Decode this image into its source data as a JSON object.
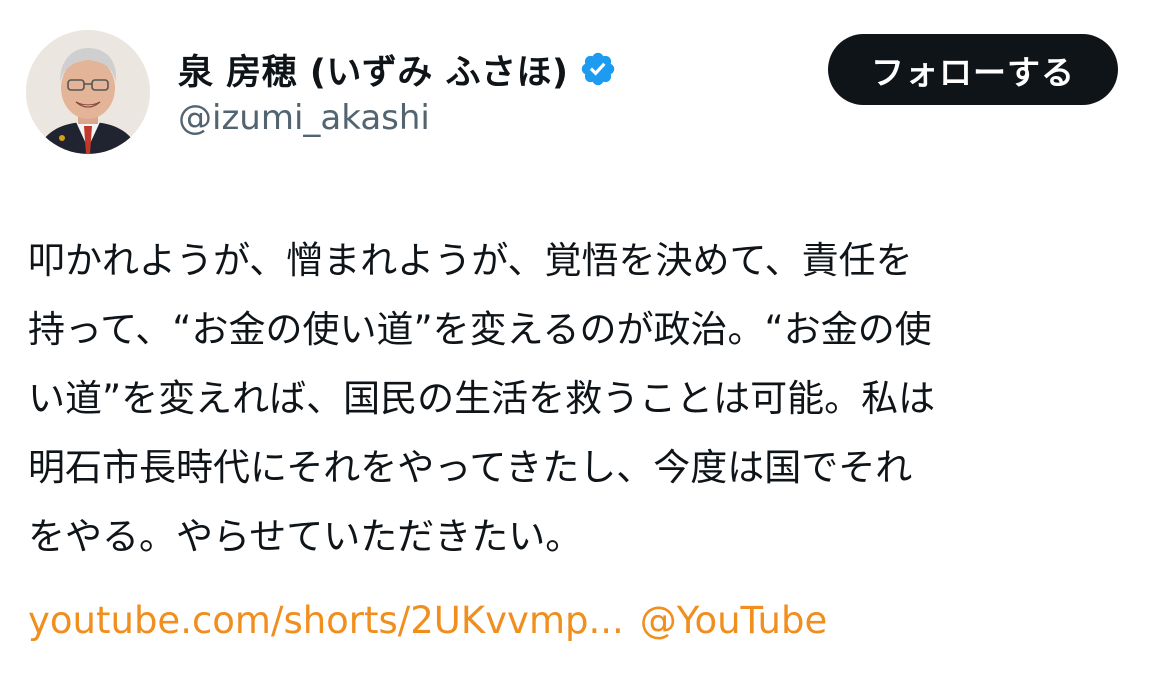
{
  "author": {
    "display_name": "泉 房穂 (いずみ ふさほ)",
    "handle": "@izumi_akashi",
    "verified_badge_icon": "verified-checkmark-icon",
    "verified_color": "#1d9bf0"
  },
  "follow_button": {
    "label": "フォローする"
  },
  "tweet": {
    "lines": [
      "叩かれようが、憎まれようが、覚悟を決めて、責任を",
      "持って、“お金の使い道”を変えるのが政治。“お金の使",
      "い道”を変えれば、国民の生活を救うことは可能。私は",
      "明石市長時代にそれをやってきたし、今度は国でそれ",
      "をやる。やらせていただきたい。"
    ],
    "link_url_text": "youtube.com/shorts/2UKvvmp...",
    "link_mention": "@YouTube",
    "link_color": "#f08e1e"
  }
}
